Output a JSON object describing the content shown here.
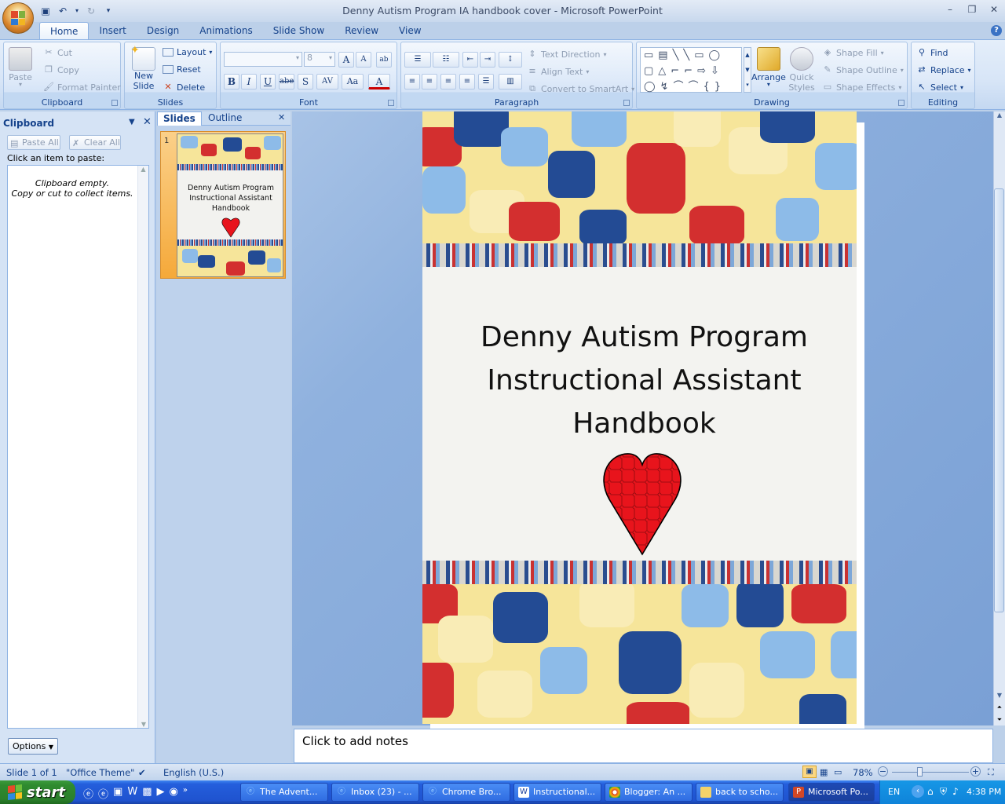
{
  "window": {
    "title": "Denny Autism Program IA handbook cover - Microsoft PowerPoint"
  },
  "ribbon_tabs": [
    "Home",
    "Insert",
    "Design",
    "Animations",
    "Slide Show",
    "Review",
    "View"
  ],
  "clipboard_group": {
    "label": "Clipboard",
    "paste": "Paste",
    "cut": "Cut",
    "copy": "Copy",
    "format_painter": "Format Painter"
  },
  "slides_group": {
    "label": "Slides",
    "new_slide": "New Slide",
    "layout": "Layout",
    "reset": "Reset",
    "delete": "Delete"
  },
  "font_group": {
    "label": "Font",
    "font_name": "",
    "font_size": "8"
  },
  "paragraph_group": {
    "label": "Paragraph",
    "text_direction": "Text Direction",
    "align_text": "Align Text",
    "convert_smartart": "Convert to SmartArt"
  },
  "drawing_group": {
    "label": "Drawing",
    "arrange": "Arrange",
    "quick_styles": "Quick Styles",
    "shape_fill": "Shape Fill",
    "shape_outline": "Shape Outline",
    "shape_effects": "Shape Effects"
  },
  "editing_group": {
    "label": "Editing",
    "find": "Find",
    "replace": "Replace",
    "select": "Select"
  },
  "clipboard_pane": {
    "title": "Clipboard",
    "paste_all": "Paste All",
    "clear_all": "Clear All",
    "hint": "Click an item to paste:",
    "empty_line1": "Clipboard empty.",
    "empty_line2": "Copy or cut to collect items.",
    "options": "Options"
  },
  "slides_pane": {
    "tab_slides": "Slides",
    "tab_outline": "Outline",
    "slide_number": "1",
    "thumb_line1": "Denny Autism Program",
    "thumb_line2": "Instructional Assistant",
    "thumb_line3": "Handbook"
  },
  "slide": {
    "title_line1": "Denny Autism Program",
    "title_line2": "Instructional Assistant",
    "title_line3": "Handbook"
  },
  "notes": {
    "placeholder": "Click to add notes"
  },
  "status_bar": {
    "slide_count": "Slide 1 of 1",
    "theme": "\"Office Theme\"",
    "language": "English (U.S.)",
    "zoom": "78%"
  },
  "taskbar": {
    "start": "start",
    "buttons": [
      "The Advent...",
      "Inbox (23) - ...",
      "Chrome Bro...",
      "Instructional...",
      "Blogger: An ...",
      "back to scho...",
      "Microsoft Po..."
    ],
    "lang": "EN",
    "clock": "4:38 PM"
  },
  "colors": {
    "puzzle_yellow": "#f6e59a",
    "puzzle_red": "#d32f2f",
    "puzzle_blue": "#234b94",
    "puzzle_lightblue": "#8dbbe8",
    "heart_red": "#e8141c"
  }
}
